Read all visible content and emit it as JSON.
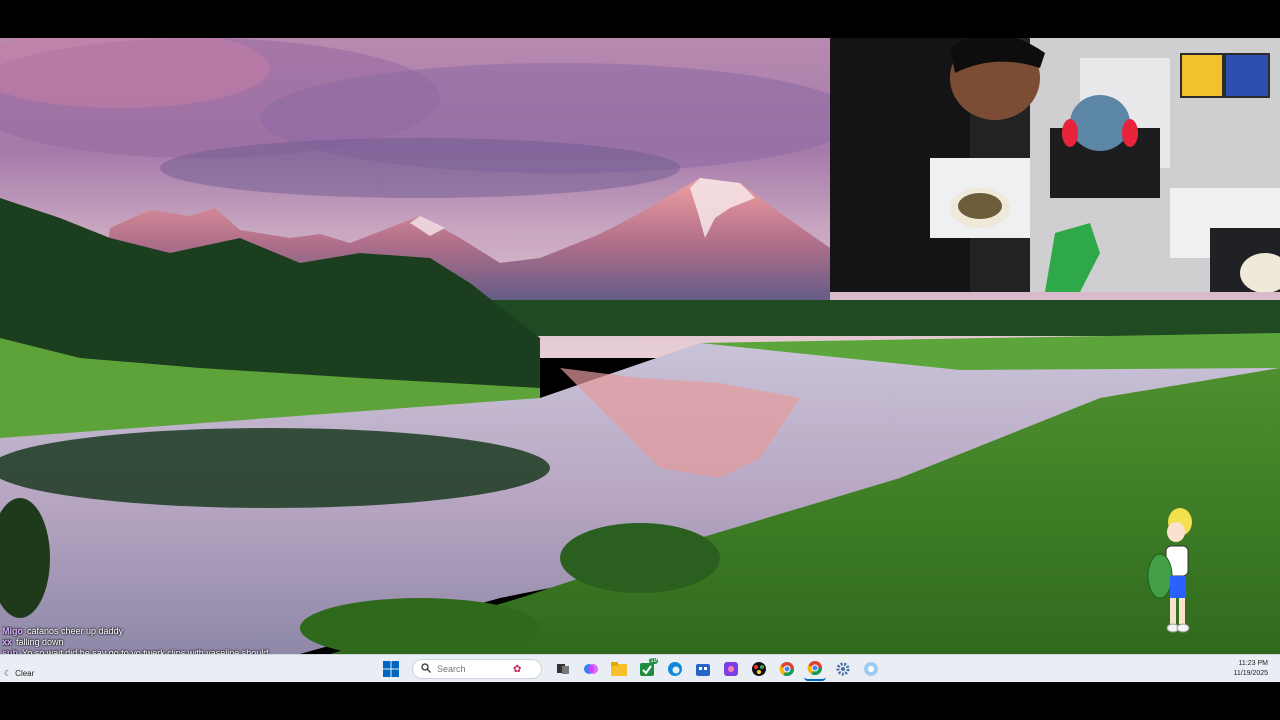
{
  "chat": {
    "messages": [
      {
        "user": "Migo",
        "text": "cafanos cheer up daddy"
      },
      {
        "user": "xx",
        "text": "falling down"
      },
      {
        "user": "sub",
        "text": "Yo so wait did he say go to yo twerk clips with vaseline should"
      }
    ]
  },
  "taskbar": {
    "weather_label": "Clear",
    "search_placeholder": "Search",
    "pinned_icons": [
      "windows-start-icon",
      "search-icon",
      "widgets-icon",
      "task-view-icon",
      "copilot-icon",
      "file-explorer-icon",
      "calendar-badge-icon",
      "edge-icon",
      "store-icon",
      "photos-icon",
      "game-icon",
      "chrome-icon",
      "chrome-alt-icon",
      "settings-gear-icon",
      "browser-icon"
    ],
    "calendar_badge": "19",
    "clock_time": "11:23 PM",
    "clock_date": "11/19/2025"
  },
  "colors": {
    "taskbar_bg": "#e9eef4",
    "accent": "#0067c0"
  }
}
